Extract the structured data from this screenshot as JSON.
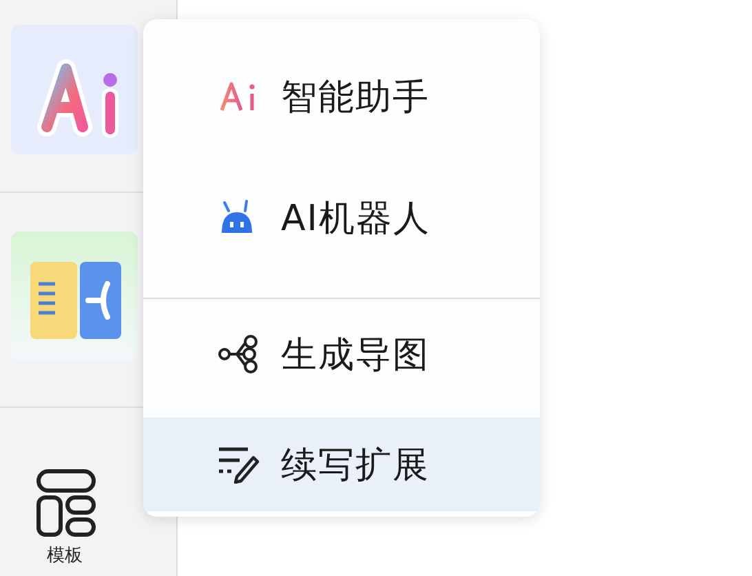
{
  "sidebar": {
    "items": [
      {
        "kind": "ai"
      },
      {
        "kind": "split"
      },
      {
        "kind": "template",
        "label": "模板"
      }
    ]
  },
  "menu": {
    "items": [
      {
        "kind": "ai",
        "label": "智能助手",
        "selected": false,
        "separator_before": false
      },
      {
        "kind": "robot",
        "label": "AI机器人",
        "selected": false,
        "separator_before": false
      },
      {
        "kind": "mindmap",
        "label": "生成导图",
        "selected": false,
        "separator_before": true
      },
      {
        "kind": "write",
        "label": "续写扩展",
        "selected": true,
        "separator_before": false
      }
    ]
  }
}
